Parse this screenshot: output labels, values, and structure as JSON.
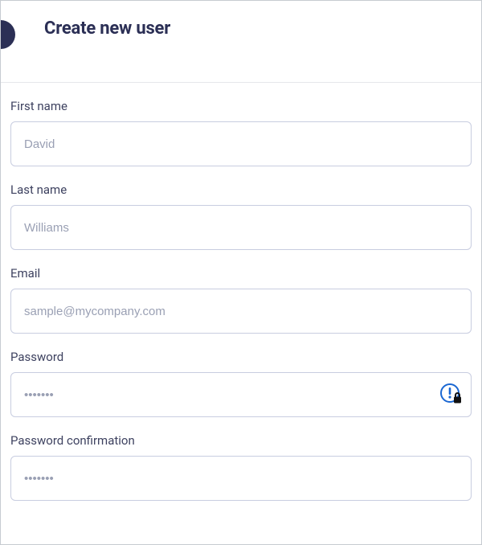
{
  "header": {
    "title": "Create new user"
  },
  "fields": {
    "first_name": {
      "label": "First name",
      "placeholder": "David",
      "value": ""
    },
    "last_name": {
      "label": "Last name",
      "placeholder": "Williams",
      "value": ""
    },
    "email": {
      "label": "Email",
      "placeholder": "sample@mycompany.com",
      "value": ""
    },
    "password": {
      "label": "Password",
      "placeholder": "•••••••",
      "value": ""
    },
    "password_confirmation": {
      "label": "Password confirmation",
      "placeholder": "•••••••",
      "value": ""
    }
  },
  "icons": {
    "password_manager": "1password-lock-icon"
  }
}
